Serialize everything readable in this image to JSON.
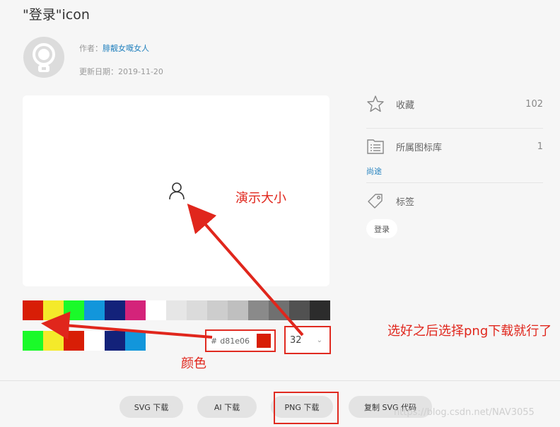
{
  "title": "\"登录\"icon",
  "author": {
    "label": "作者：",
    "name": "腓靓女嘅女人"
  },
  "updated": {
    "label": "更新日期：",
    "value": "2019-11-20"
  },
  "palette": {
    "row1": [
      "#d81e06",
      "#f4ea2a",
      "#1afa29",
      "#1296db",
      "#13227a",
      "#d4237a",
      "#ffffff",
      "#e6e6e6",
      "#dbdbdb",
      "#cdcdcd",
      "#bfbfbf",
      "#8a8a8a",
      "#707070",
      "#515151",
      "#2c2c2c"
    ],
    "row2": [
      "#1afa29",
      "#f4ea2a",
      "#d81e06",
      "#ffffff",
      "#13227a",
      "#1296db"
    ]
  },
  "color_input": {
    "hash": "#",
    "value": "d81e06",
    "chip": "#d81e06"
  },
  "size_select": {
    "value": "32"
  },
  "annotations": {
    "size": "演示大小",
    "color": "颜色",
    "tip": "选好之后选择png下载就行了"
  },
  "sidebar": {
    "favorite": {
      "label": "收藏",
      "count": "102"
    },
    "library": {
      "label": "所属图标库",
      "count": "1"
    },
    "usage": "尚途",
    "tags": {
      "label": "标签",
      "chip": "登录"
    }
  },
  "buttons": {
    "svg": "SVG 下载",
    "ai": "AI 下载",
    "png": "PNG 下载",
    "copy": "复制 SVG 代码"
  },
  "watermark": "https://blog.csdn.net/NAV3055",
  "colors": {
    "annotation_red": "#e0261c",
    "link_blue": "#1f7fbd"
  }
}
